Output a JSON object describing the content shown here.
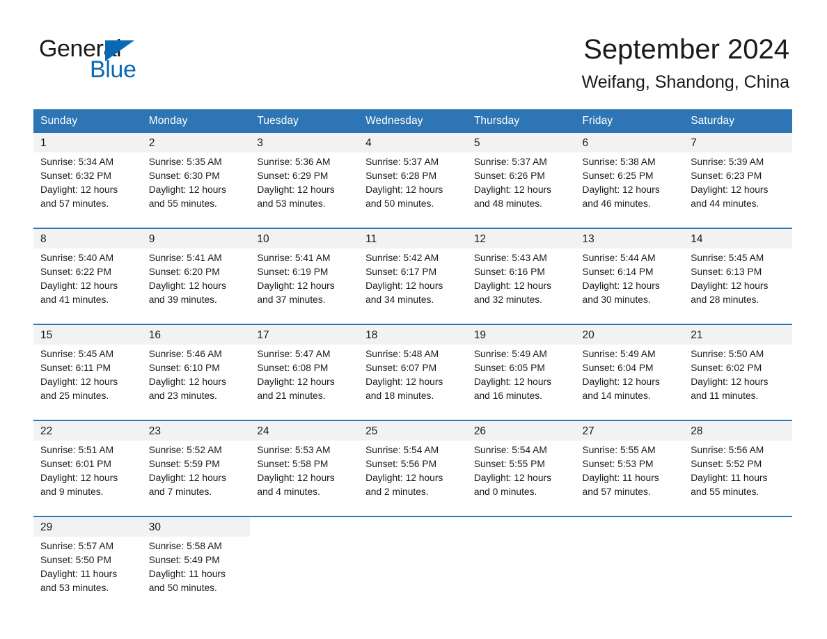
{
  "logo": {
    "word1": "General",
    "word2": "Blue",
    "triangle_color": "#0a69b5"
  },
  "header": {
    "title": "September 2024",
    "subtitle": "Weifang, Shandong, China",
    "accent_color": "#2e75b6",
    "daynum_bg": "#f2f2f2"
  },
  "weekdays": [
    "Sunday",
    "Monday",
    "Tuesday",
    "Wednesday",
    "Thursday",
    "Friday",
    "Saturday"
  ],
  "weeks": [
    {
      "days": [
        {
          "num": "1",
          "sunrise": "Sunrise: 5:34 AM",
          "sunset": "Sunset: 6:32 PM",
          "daylight1": "Daylight: 12 hours",
          "daylight2": "and 57 minutes."
        },
        {
          "num": "2",
          "sunrise": "Sunrise: 5:35 AM",
          "sunset": "Sunset: 6:30 PM",
          "daylight1": "Daylight: 12 hours",
          "daylight2": "and 55 minutes."
        },
        {
          "num": "3",
          "sunrise": "Sunrise: 5:36 AM",
          "sunset": "Sunset: 6:29 PM",
          "daylight1": "Daylight: 12 hours",
          "daylight2": "and 53 minutes."
        },
        {
          "num": "4",
          "sunrise": "Sunrise: 5:37 AM",
          "sunset": "Sunset: 6:28 PM",
          "daylight1": "Daylight: 12 hours",
          "daylight2": "and 50 minutes."
        },
        {
          "num": "5",
          "sunrise": "Sunrise: 5:37 AM",
          "sunset": "Sunset: 6:26 PM",
          "daylight1": "Daylight: 12 hours",
          "daylight2": "and 48 minutes."
        },
        {
          "num": "6",
          "sunrise": "Sunrise: 5:38 AM",
          "sunset": "Sunset: 6:25 PM",
          "daylight1": "Daylight: 12 hours",
          "daylight2": "and 46 minutes."
        },
        {
          "num": "7",
          "sunrise": "Sunrise: 5:39 AM",
          "sunset": "Sunset: 6:23 PM",
          "daylight1": "Daylight: 12 hours",
          "daylight2": "and 44 minutes."
        }
      ]
    },
    {
      "days": [
        {
          "num": "8",
          "sunrise": "Sunrise: 5:40 AM",
          "sunset": "Sunset: 6:22 PM",
          "daylight1": "Daylight: 12 hours",
          "daylight2": "and 41 minutes."
        },
        {
          "num": "9",
          "sunrise": "Sunrise: 5:41 AM",
          "sunset": "Sunset: 6:20 PM",
          "daylight1": "Daylight: 12 hours",
          "daylight2": "and 39 minutes."
        },
        {
          "num": "10",
          "sunrise": "Sunrise: 5:41 AM",
          "sunset": "Sunset: 6:19 PM",
          "daylight1": "Daylight: 12 hours",
          "daylight2": "and 37 minutes."
        },
        {
          "num": "11",
          "sunrise": "Sunrise: 5:42 AM",
          "sunset": "Sunset: 6:17 PM",
          "daylight1": "Daylight: 12 hours",
          "daylight2": "and 34 minutes."
        },
        {
          "num": "12",
          "sunrise": "Sunrise: 5:43 AM",
          "sunset": "Sunset: 6:16 PM",
          "daylight1": "Daylight: 12 hours",
          "daylight2": "and 32 minutes."
        },
        {
          "num": "13",
          "sunrise": "Sunrise: 5:44 AM",
          "sunset": "Sunset: 6:14 PM",
          "daylight1": "Daylight: 12 hours",
          "daylight2": "and 30 minutes."
        },
        {
          "num": "14",
          "sunrise": "Sunrise: 5:45 AM",
          "sunset": "Sunset: 6:13 PM",
          "daylight1": "Daylight: 12 hours",
          "daylight2": "and 28 minutes."
        }
      ]
    },
    {
      "days": [
        {
          "num": "15",
          "sunrise": "Sunrise: 5:45 AM",
          "sunset": "Sunset: 6:11 PM",
          "daylight1": "Daylight: 12 hours",
          "daylight2": "and 25 minutes."
        },
        {
          "num": "16",
          "sunrise": "Sunrise: 5:46 AM",
          "sunset": "Sunset: 6:10 PM",
          "daylight1": "Daylight: 12 hours",
          "daylight2": "and 23 minutes."
        },
        {
          "num": "17",
          "sunrise": "Sunrise: 5:47 AM",
          "sunset": "Sunset: 6:08 PM",
          "daylight1": "Daylight: 12 hours",
          "daylight2": "and 21 minutes."
        },
        {
          "num": "18",
          "sunrise": "Sunrise: 5:48 AM",
          "sunset": "Sunset: 6:07 PM",
          "daylight1": "Daylight: 12 hours",
          "daylight2": "and 18 minutes."
        },
        {
          "num": "19",
          "sunrise": "Sunrise: 5:49 AM",
          "sunset": "Sunset: 6:05 PM",
          "daylight1": "Daylight: 12 hours",
          "daylight2": "and 16 minutes."
        },
        {
          "num": "20",
          "sunrise": "Sunrise: 5:49 AM",
          "sunset": "Sunset: 6:04 PM",
          "daylight1": "Daylight: 12 hours",
          "daylight2": "and 14 minutes."
        },
        {
          "num": "21",
          "sunrise": "Sunrise: 5:50 AM",
          "sunset": "Sunset: 6:02 PM",
          "daylight1": "Daylight: 12 hours",
          "daylight2": "and 11 minutes."
        }
      ]
    },
    {
      "days": [
        {
          "num": "22",
          "sunrise": "Sunrise: 5:51 AM",
          "sunset": "Sunset: 6:01 PM",
          "daylight1": "Daylight: 12 hours",
          "daylight2": "and 9 minutes."
        },
        {
          "num": "23",
          "sunrise": "Sunrise: 5:52 AM",
          "sunset": "Sunset: 5:59 PM",
          "daylight1": "Daylight: 12 hours",
          "daylight2": "and 7 minutes."
        },
        {
          "num": "24",
          "sunrise": "Sunrise: 5:53 AM",
          "sunset": "Sunset: 5:58 PM",
          "daylight1": "Daylight: 12 hours",
          "daylight2": "and 4 minutes."
        },
        {
          "num": "25",
          "sunrise": "Sunrise: 5:54 AM",
          "sunset": "Sunset: 5:56 PM",
          "daylight1": "Daylight: 12 hours",
          "daylight2": "and 2 minutes."
        },
        {
          "num": "26",
          "sunrise": "Sunrise: 5:54 AM",
          "sunset": "Sunset: 5:55 PM",
          "daylight1": "Daylight: 12 hours",
          "daylight2": "and 0 minutes."
        },
        {
          "num": "27",
          "sunrise": "Sunrise: 5:55 AM",
          "sunset": "Sunset: 5:53 PM",
          "daylight1": "Daylight: 11 hours",
          "daylight2": "and 57 minutes."
        },
        {
          "num": "28",
          "sunrise": "Sunrise: 5:56 AM",
          "sunset": "Sunset: 5:52 PM",
          "daylight1": "Daylight: 11 hours",
          "daylight2": "and 55 minutes."
        }
      ]
    },
    {
      "days": [
        {
          "num": "29",
          "sunrise": "Sunrise: 5:57 AM",
          "sunset": "Sunset: 5:50 PM",
          "daylight1": "Daylight: 11 hours",
          "daylight2": "and 53 minutes."
        },
        {
          "num": "30",
          "sunrise": "Sunrise: 5:58 AM",
          "sunset": "Sunset: 5:49 PM",
          "daylight1": "Daylight: 11 hours",
          "daylight2": "and 50 minutes."
        },
        {
          "num": "",
          "sunrise": "",
          "sunset": "",
          "daylight1": "",
          "daylight2": ""
        },
        {
          "num": "",
          "sunrise": "",
          "sunset": "",
          "daylight1": "",
          "daylight2": ""
        },
        {
          "num": "",
          "sunrise": "",
          "sunset": "",
          "daylight1": "",
          "daylight2": ""
        },
        {
          "num": "",
          "sunrise": "",
          "sunset": "",
          "daylight1": "",
          "daylight2": ""
        },
        {
          "num": "",
          "sunrise": "",
          "sunset": "",
          "daylight1": "",
          "daylight2": ""
        }
      ]
    }
  ]
}
